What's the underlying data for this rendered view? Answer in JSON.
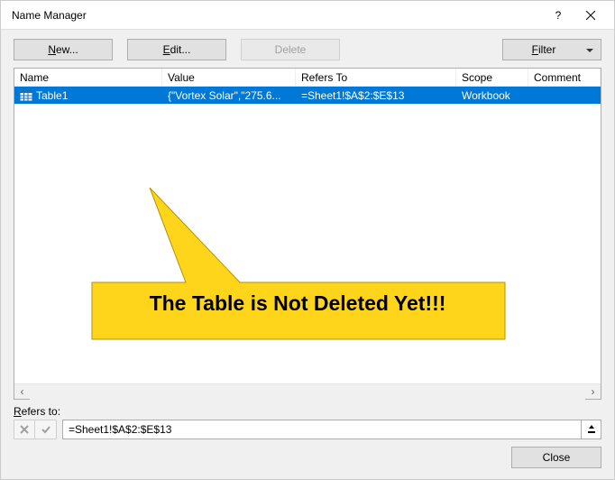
{
  "title": "Name Manager",
  "toolbar": {
    "new_label": "New...",
    "new_key": "N",
    "edit_label": "Edit...",
    "edit_key": "E",
    "delete_label": "Delete",
    "delete_key": "D",
    "filter_label": "Filter",
    "filter_key": "F"
  },
  "columns": {
    "name": "Name",
    "value": "Value",
    "refers_to": "Refers To",
    "scope": "Scope",
    "comment": "Comment"
  },
  "rows": [
    {
      "name": "Table1",
      "value": "{\"Vortex Solar\",\"275.6...",
      "refers_to": "=Sheet1!$A$2:$E$13",
      "scope": "Workbook",
      "comment": ""
    }
  ],
  "callout_text": "The Table is Not Deleted Yet!!!",
  "refers_to_label": "Refers to:",
  "refers_to_value": "=Sheet1!$A$2:$E$13",
  "close_label": "Close",
  "help_glyph": "?"
}
